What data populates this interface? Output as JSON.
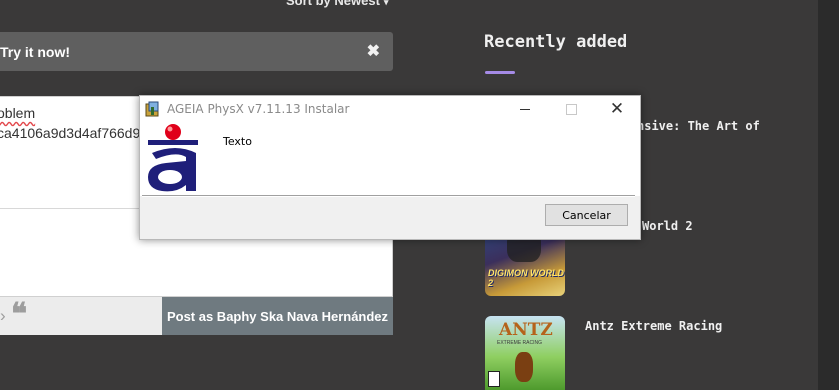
{
  "page": {
    "sort_label": "Sort by Newest"
  },
  "banner": {
    "text": "Try it now!",
    "close_glyph": "✖"
  },
  "comment": {
    "line1": "oblem",
    "line2": "ca4106a9d3d4af766d9",
    "toolbar_chevron": "›",
    "toolbar_quote": "❝",
    "post_button": "Post as Baphy Ska Nava Hernández"
  },
  "sidebar": {
    "heading": "Recently added",
    "items": [
      {
        "title": "nsive: The Art of"
      },
      {
        "title": "World 2",
        "thumb_text": "DIGIMON WORLD 2"
      },
      {
        "title": "Antz Extreme Racing",
        "thumb_text": "ANTZ",
        "thumb_subtext": "EXTREME RACING"
      }
    ]
  },
  "dialog": {
    "title": "AGEIA PhysX v7.11.13 Instalar",
    "message": "Texto",
    "cancel_label": "Cancelar",
    "close_glyph": "✕",
    "app_icon": "installer-icon",
    "logo": "ageia-logo"
  },
  "colors": {
    "page_bg": "#3a3939",
    "accent_underline": "#a58be6",
    "post_button_bg": "#6f7a80",
    "banner_bg": "#5f5f5f",
    "ageia_blue": "#1f1f7a",
    "ageia_red": "#e0001a"
  }
}
